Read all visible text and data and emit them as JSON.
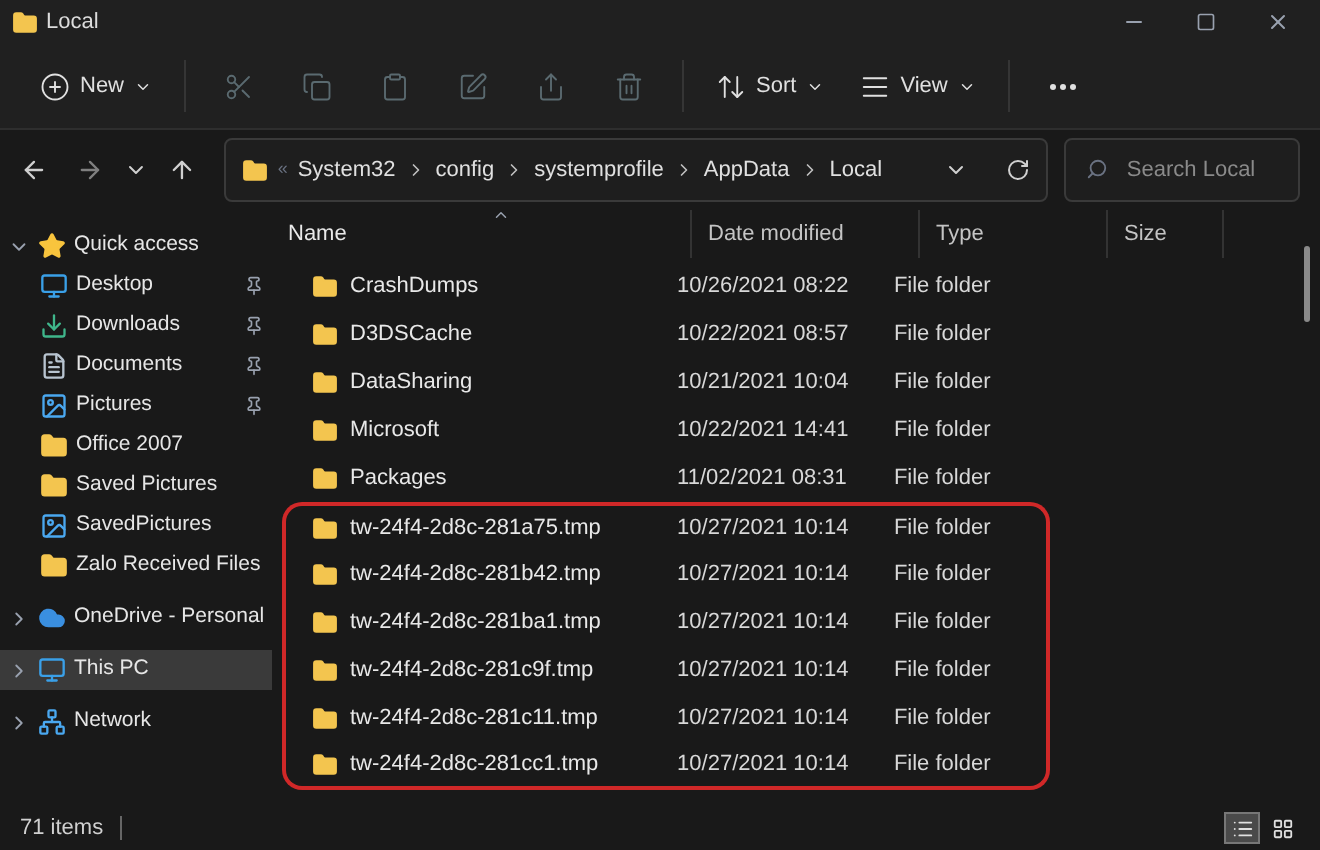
{
  "window": {
    "title": "Local"
  },
  "toolbar": [
    {
      "kind": "new",
      "label": "New",
      "disabled": false
    },
    {
      "kind": "cut",
      "disabled": true
    },
    {
      "kind": "copy",
      "disabled": true
    },
    {
      "kind": "paste",
      "disabled": true
    },
    {
      "kind": "rename",
      "disabled": true
    },
    {
      "kind": "share",
      "disabled": true
    },
    {
      "kind": "delete",
      "disabled": true
    },
    {
      "kind": "sort",
      "label": "Sort",
      "disabled": false
    },
    {
      "kind": "view",
      "label": "View",
      "disabled": false
    },
    {
      "kind": "more",
      "disabled": false
    }
  ],
  "address": {
    "overflow": "«",
    "path": [
      "System32",
      "config",
      "systemprofile",
      "AppData",
      "Local"
    ]
  },
  "search": {
    "placeholder": "Search Local"
  },
  "sidebar": {
    "items": [
      {
        "label": "Quick access",
        "kind": "star",
        "expanded": true,
        "selected": false,
        "children": [
          {
            "label": "Desktop",
            "kind": "desktop",
            "pinned": true,
            "selected": false
          },
          {
            "label": "Downloads",
            "kind": "downloads",
            "pinned": true,
            "selected": false
          },
          {
            "label": "Documents",
            "kind": "documents",
            "pinned": true,
            "selected": false
          },
          {
            "label": "Pictures",
            "kind": "pictures",
            "pinned": true,
            "selected": false
          },
          {
            "label": "Office 2007",
            "kind": "folder",
            "pinned": false,
            "selected": false
          },
          {
            "label": "Saved Pictures",
            "kind": "folder",
            "pinned": false,
            "selected": false
          },
          {
            "label": "SavedPictures",
            "kind": "pictures",
            "pinned": false,
            "selected": false
          },
          {
            "label": "Zalo Received Files",
            "kind": "folder",
            "pinned": false,
            "selected": false
          }
        ]
      },
      {
        "label": "OneDrive - Personal",
        "kind": "cloud",
        "expanded": false,
        "selected": false
      },
      {
        "label": "This PC",
        "kind": "pc",
        "expanded": false,
        "selected": true
      },
      {
        "label": "Network",
        "kind": "network",
        "expanded": false,
        "selected": false
      }
    ]
  },
  "table": {
    "columns": [
      {
        "label": "Name",
        "sorted": true
      },
      {
        "label": "Date modified",
        "sorted": false
      },
      {
        "label": "Type",
        "sorted": false
      },
      {
        "label": "Size",
        "sorted": false
      }
    ],
    "rows": [
      {
        "name": "CrashDumps",
        "date": "10/26/2021 08:22",
        "type": "File folder",
        "highlighted": false
      },
      {
        "name": "D3DSCache",
        "date": "10/22/2021 08:57",
        "type": "File folder",
        "highlighted": false
      },
      {
        "name": "DataSharing",
        "date": "10/21/2021 10:04",
        "type": "File folder",
        "highlighted": false
      },
      {
        "name": "Microsoft",
        "date": "10/22/2021 14:41",
        "type": "File folder",
        "highlighted": false
      },
      {
        "name": "Packages",
        "date": "11/02/2021 08:31",
        "type": "File folder",
        "highlighted": false
      },
      {
        "name": "tw-24f4-2d8c-281a75.tmp",
        "date": "10/27/2021 10:14",
        "type": "File folder",
        "highlighted": true
      },
      {
        "name": "tw-24f4-2d8c-281b42.tmp",
        "date": "10/27/2021 10:14",
        "type": "File folder",
        "highlighted": true
      },
      {
        "name": "tw-24f4-2d8c-281ba1.tmp",
        "date": "10/27/2021 10:14",
        "type": "File folder",
        "highlighted": true
      },
      {
        "name": "tw-24f4-2d8c-281c9f.tmp",
        "date": "10/27/2021 10:14",
        "type": "File folder",
        "highlighted": true
      },
      {
        "name": "tw-24f4-2d8c-281c11.tmp",
        "date": "10/27/2021 10:14",
        "type": "File folder",
        "highlighted": true
      },
      {
        "name": "tw-24f4-2d8c-281cc1.tmp",
        "date": "10/27/2021 10:14",
        "type": "File folder",
        "highlighted": true
      }
    ]
  },
  "status_bar": {
    "count": "71 items",
    "views": [
      {
        "kind": "details",
        "selected": true
      },
      {
        "kind": "tiles",
        "selected": false
      }
    ]
  }
}
